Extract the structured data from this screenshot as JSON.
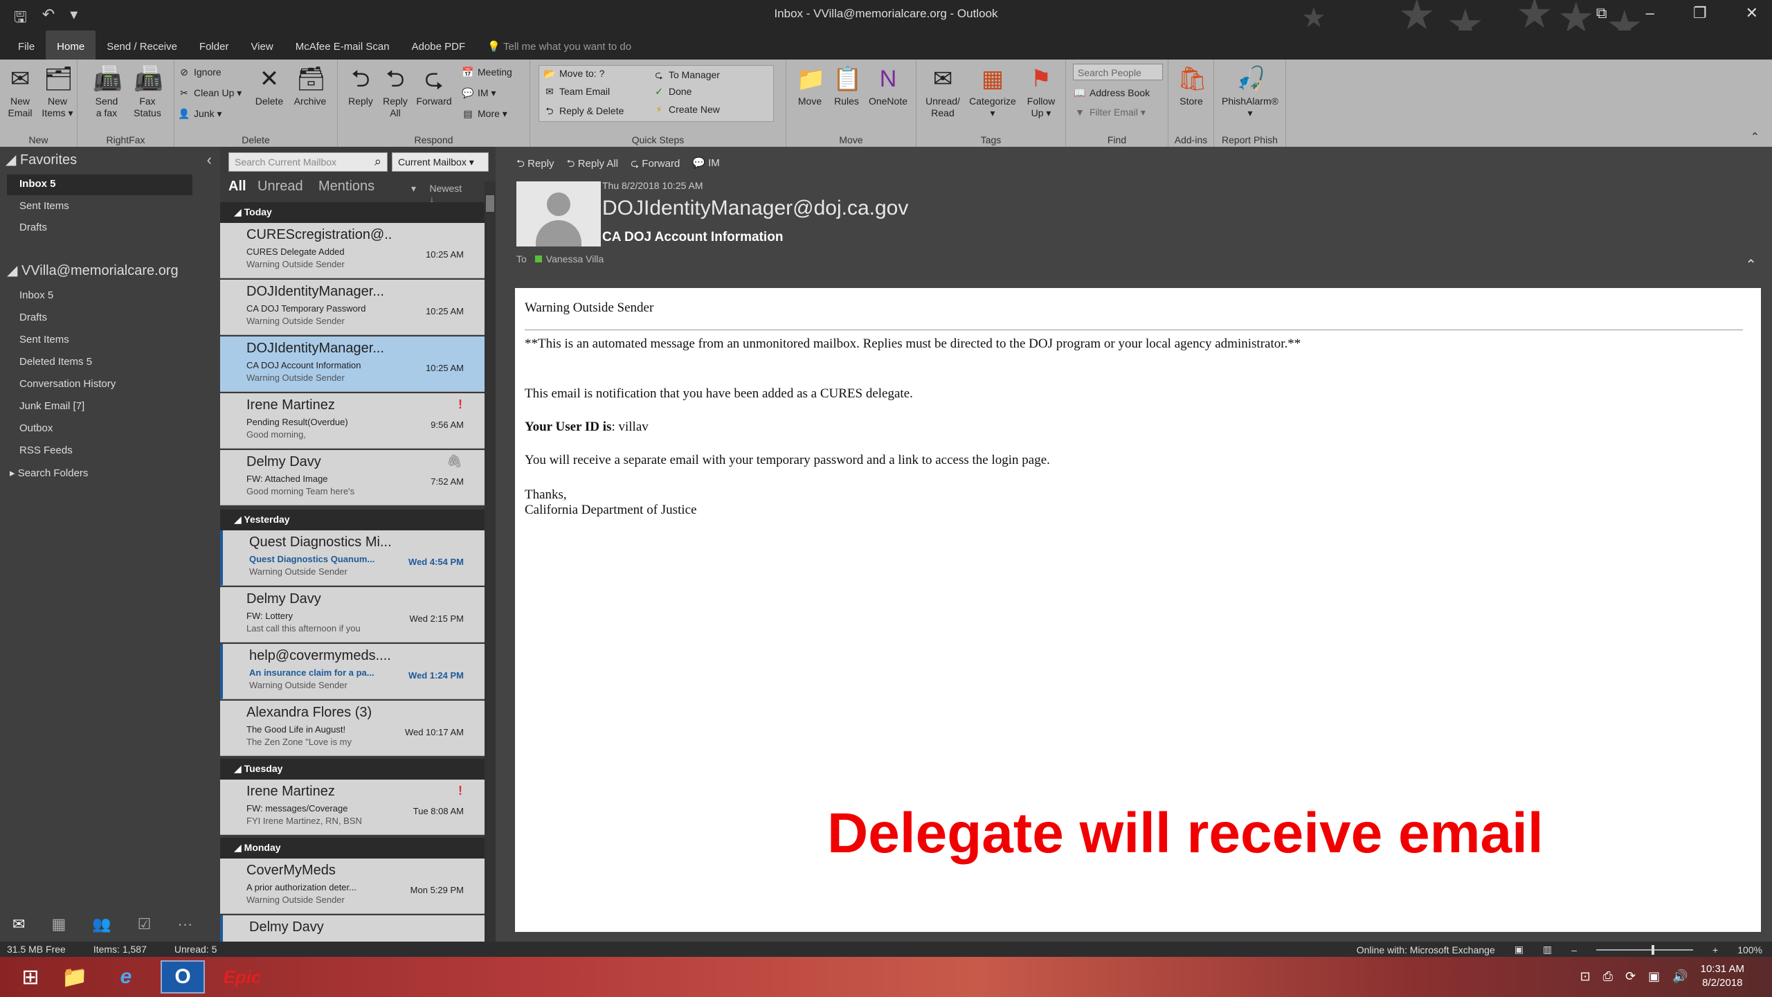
{
  "window": {
    "title": "Inbox - VVilla@memorialcare.org - Outlook",
    "controls": [
      "⧉",
      "–",
      "❐",
      "✕"
    ]
  },
  "qat": [
    "🖫",
    "↶",
    "▾"
  ],
  "tabs": [
    "File",
    "Home",
    "Send / Receive",
    "Folder",
    "View",
    "McAfee E-mail Scan",
    "Adobe PDF"
  ],
  "active_tab": "Home",
  "tell_me": "Tell me what you want to do",
  "ribbon": {
    "groups": {
      "new": "New",
      "rightfax": "RightFax",
      "delete": "Delete",
      "respond": "Respond",
      "quicksteps": "Quick Steps",
      "move": "Move",
      "tags": "Tags",
      "find": "Find",
      "addins": "Add-ins",
      "reportphish": "Report Phish"
    },
    "new_email": [
      "New",
      "Email"
    ],
    "new_items": [
      "New",
      "Items ▾"
    ],
    "send_fax": [
      "Send",
      "a fax"
    ],
    "fax_status": [
      "Fax",
      "Status"
    ],
    "ignore": "Ignore",
    "cleanup": "Clean Up ▾",
    "junk": "Junk ▾",
    "delete": "Delete",
    "archive": "Archive",
    "reply": "Reply",
    "reply_all": [
      "Reply",
      "All"
    ],
    "forward": "Forward",
    "meeting": "Meeting",
    "im": "IM ▾",
    "more": "More ▾",
    "qs_move": "Move to: ?",
    "qs_team": "Team Email",
    "qs_replydel": "Reply & Delete",
    "qs_manager": "To Manager",
    "qs_done": "Done",
    "qs_create": "Create New",
    "move": "Move",
    "rules": "Rules",
    "onenote": "OneNote",
    "unread_read": [
      "Unread/",
      "Read"
    ],
    "categorize": "Categorize",
    "follow_up": [
      "Follow",
      "Up ▾"
    ],
    "search_people": "Search People",
    "address_book": "Address Book",
    "filter_email": "Filter Email ▾",
    "store": "Store",
    "phishalarm": "PhishAlarm®"
  },
  "sidebar": {
    "favorites_label": "Favorites",
    "favorites": [
      {
        "label": "Inbox  5",
        "bold": true
      },
      {
        "label": "Sent Items",
        "bold": false
      },
      {
        "label": "Drafts",
        "bold": false
      }
    ],
    "account": "VVilla@memorialcare.org",
    "folders": [
      {
        "label": "Inbox  5"
      },
      {
        "label": "Drafts"
      },
      {
        "label": "Sent Items"
      },
      {
        "label": "Deleted Items  5"
      },
      {
        "label": "Conversation History"
      },
      {
        "label": "Junk Email [7]"
      },
      {
        "label": "Outbox"
      },
      {
        "label": "RSS Feeds"
      }
    ],
    "search_folders": "▸ Search Folders",
    "nav_icons": [
      "✉",
      "▦",
      "👥",
      "☑",
      "···"
    ]
  },
  "search": {
    "placeholder": "Search Current Mailbox",
    "scope": "Current Mailbox  ▾"
  },
  "filters": {
    "all": "All",
    "unread": "Unread",
    "mentions": "Mentions",
    "sort": "Newest ↓"
  },
  "groups": [
    "◢ Today",
    "◢ Yesterday",
    "◢ Tuesday",
    "◢ Monday"
  ],
  "messages": [
    {
      "from": "CUREScregistration@...",
      "subject": "CURES Delegate Added",
      "preview": "Warning Outside Sender",
      "time": "10:25 AM",
      "group": 0
    },
    {
      "from": "DOJIdentityManager...",
      "subject": "CA DOJ Temporary Password",
      "preview": "Warning Outside Sender",
      "time": "10:25 AM",
      "group": 0
    },
    {
      "from": "DOJIdentityManager...",
      "subject": "CA DOJ Account Information",
      "preview": "Warning Outside Sender",
      "time": "10:25 AM",
      "group": 0,
      "selected": true
    },
    {
      "from": "Irene Martinez",
      "subject": "Pending Result(Overdue)",
      "preview": "Good morning,",
      "time": "9:56 AM",
      "group": 0,
      "flag": "!"
    },
    {
      "from": "Delmy Davy",
      "subject": "FW: Attached Image",
      "preview": "Good morning Team here's",
      "time": "7:52 AM",
      "group": 0,
      "attach": "🖇"
    },
    {
      "from": "Quest Diagnostics Mi...",
      "subject": "Quest Diagnostics Quanum...",
      "preview": "Warning Outside Sender",
      "time": "Wed 4:54 PM",
      "group": 1,
      "unread": true
    },
    {
      "from": "Delmy Davy",
      "subject": "FW: Lottery",
      "preview": "Last call this afternoon if you",
      "time": "Wed 2:15 PM",
      "group": 1
    },
    {
      "from": "help@covermymeds....",
      "subject": "An insurance claim for a pa...",
      "preview": "Warning Outside Sender",
      "time": "Wed 1:24 PM",
      "group": 1,
      "unread": true
    },
    {
      "from": "Alexandra Flores (3)",
      "subject": "The Good Life in August!",
      "preview": "The Zen Zone  \"Love is my",
      "time": "Wed 10:17 AM",
      "group": 1
    },
    {
      "from": "Irene Martinez",
      "subject": "FW: messages/Coverage",
      "preview": "FYI  Irene Martinez, RN, BSN",
      "time": "Tue 8:08 AM",
      "group": 2,
      "flag": "!"
    },
    {
      "from": "CoverMyMeds",
      "subject": "A prior authorization deter...",
      "preview": "Warning Outside Sender",
      "time": "Mon 5:29 PM",
      "group": 3
    },
    {
      "from": "Delmy Davy",
      "subject": "",
      "preview": "",
      "time": "",
      "group": 3,
      "unread": true
    }
  ],
  "reading": {
    "actions": [
      "⮌ Reply",
      "⮌ Reply All",
      "⮎ Forward",
      "💬 IM"
    ],
    "date": "Thu 8/2/2018 10:25 AM",
    "from": "DOJIdentityManager@doj.ca.gov",
    "subject": "CA DOJ Account Information",
    "to_label": "To",
    "to_name": "Vanessa Villa",
    "body": {
      "warning": "Warning Outside Sender",
      "automated": "**This is an automated message from an unmonitored mailbox. Replies must be directed to the DOJ program or your local agency administrator.**",
      "line1": "This email is notification that you have been added as a CURES delegate.",
      "userid_label": "Your User ID is",
      "userid_value": ": villav",
      "line2": "You will receive a separate email with your temporary password and a link to access the login page.",
      "thanks": "Thanks,",
      "sig": "California Department of Justice"
    }
  },
  "caption": "Delegate will receive email",
  "status": {
    "free": "31.5 MB Free",
    "items": "Items: 1,587",
    "unread": "Unread: 5",
    "online": "Online with: Microsoft Exchange",
    "zoom": "100%"
  },
  "taskbar": {
    "apps": [
      "⊞",
      "📁",
      "e",
      "O",
      "Epic"
    ],
    "clock_time": "10:31 AM",
    "clock_date": "8/2/2018"
  }
}
